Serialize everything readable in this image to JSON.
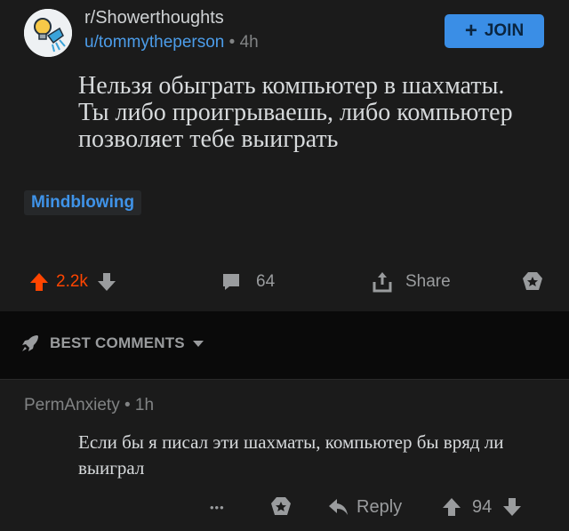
{
  "post": {
    "subreddit": "r/Showerthoughts",
    "author": "u/tommytheperson",
    "separator": "•",
    "age": "4h",
    "join_label": "JOIN",
    "title": "Нельзя обыграть компьютер в шахматы. Ты либо проигрываешь, либо компьютер позволяет тебе выиграть",
    "flair": "Mindblowing",
    "score": "2.2k",
    "comments_count": "64",
    "share_label": "Share"
  },
  "comments_header": {
    "label": "BEST COMMENTS"
  },
  "comment": {
    "author": "PermAnxiety",
    "separator": "•",
    "age": "1h",
    "text": "Если бы я писал эти шахматы, компьютер бы вряд ли выиграл",
    "more_label": "•••",
    "reply_label": "Reply",
    "score": "94"
  },
  "colors": {
    "background": "#1b1b1b",
    "accent_blue": "#3a8ee6",
    "upvote_orange": "#ff4500",
    "muted_text": "#818384"
  },
  "icons": [
    "bulb-shower-avatar-icon",
    "plus-icon",
    "upvote-icon",
    "downvote-icon",
    "comment-bubble-icon",
    "share-icon",
    "award-icon",
    "rocket-icon",
    "caret-down-icon",
    "more-dots-icon",
    "reply-arrow-icon"
  ]
}
